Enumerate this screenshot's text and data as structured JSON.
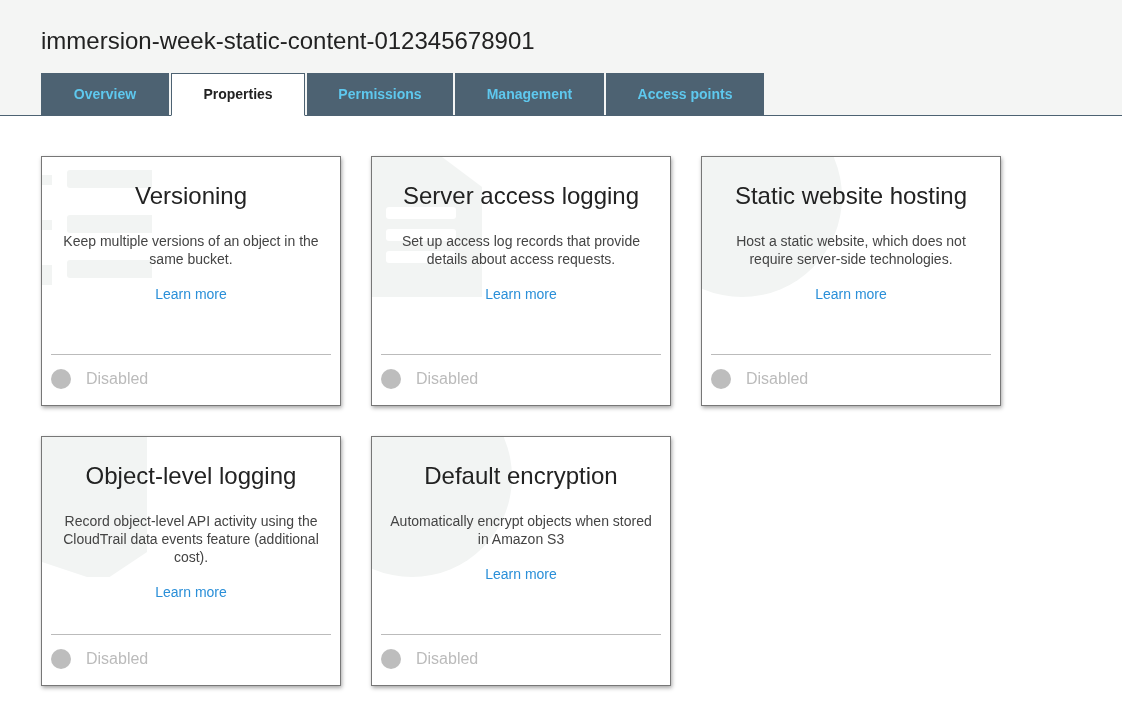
{
  "bucket_title": "immersion-week-static-content-012345678901",
  "tabs": [
    {
      "label": "Overview",
      "selected": false
    },
    {
      "label": "Properties",
      "selected": true
    },
    {
      "label": "Permissions",
      "selected": false
    },
    {
      "label": "Management",
      "selected": false
    },
    {
      "label": "Access points",
      "selected": false
    }
  ],
  "cards": [
    {
      "kind": "list",
      "title": "Versioning",
      "description": "Keep multiple versions of an object in the same bucket.",
      "link": "Learn more",
      "status": "Disabled",
      "enabled": false
    },
    {
      "kind": "document",
      "title": "Server access logging",
      "description": "Set up access log records that provide details about access requests.",
      "link": "Learn more",
      "status": "Disabled",
      "enabled": false
    },
    {
      "kind": "globe",
      "title": "Static website hosting",
      "description": "Host a static website, which does not require server-side technologies.",
      "link": "Learn more",
      "status": "Disabled",
      "enabled": false
    },
    {
      "kind": "hexagon",
      "title": "Object-level logging",
      "description": "Record object-level API activity using the CloudTrail data events feature (additional cost).",
      "link": "Learn more",
      "status": "Disabled",
      "enabled": false
    },
    {
      "kind": "globe",
      "title": "Default encryption",
      "description": "Automatically encrypt objects when stored in Amazon S3",
      "link": "Learn more",
      "status": "Disabled",
      "enabled": false
    }
  ]
}
